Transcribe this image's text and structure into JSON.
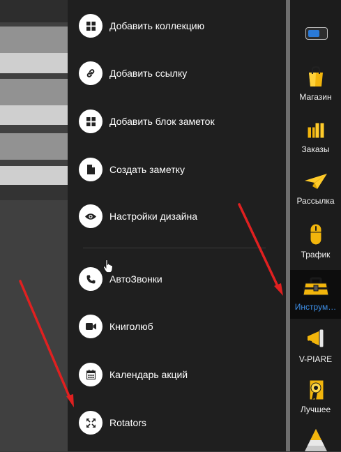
{
  "menu": {
    "items": [
      {
        "label": "Добавить коллекцию",
        "icon": "grid-icon"
      },
      {
        "label": "Добавить ссылку",
        "icon": "link-icon"
      },
      {
        "label": "Добавить блок заметок",
        "icon": "grid-icon"
      },
      {
        "label": "Создать заметку",
        "icon": "document-icon"
      },
      {
        "label": "Настройки дизайна",
        "icon": "eye-icon"
      },
      {
        "label": "АвтоЗвонки",
        "icon": "phone-icon"
      },
      {
        "label": "Книголюб",
        "icon": "video-camera-icon"
      },
      {
        "label": "Календарь акций",
        "icon": "calendar-icon"
      },
      {
        "label": "Rotators",
        "icon": "expand-arrows-icon"
      }
    ]
  },
  "sidebar": {
    "toggle_state": "on",
    "items": [
      {
        "label": "Магазин",
        "icon": "shopping-bag-icon"
      },
      {
        "label": "Заказы",
        "icon": "gift-boxes-icon"
      },
      {
        "label": "Рассылка",
        "icon": "paper-plane-icon"
      },
      {
        "label": "Трафик",
        "icon": "mouse-icon"
      },
      {
        "label": "Инструм…",
        "icon": "toolbox-icon",
        "active": true
      },
      {
        "label": "V-PIARE",
        "icon": "megaphone-icon"
      },
      {
        "label": "Лучшее",
        "icon": "award-icon"
      },
      {
        "label": "",
        "icon": "pyramid-icon"
      }
    ]
  },
  "colors": {
    "panel": "#1f1f1f",
    "sidebar": "#1c1c1c",
    "accent_blue": "#3d8ee6",
    "arrow_red": "#e02020",
    "icon_yellow": "#f2c014"
  }
}
